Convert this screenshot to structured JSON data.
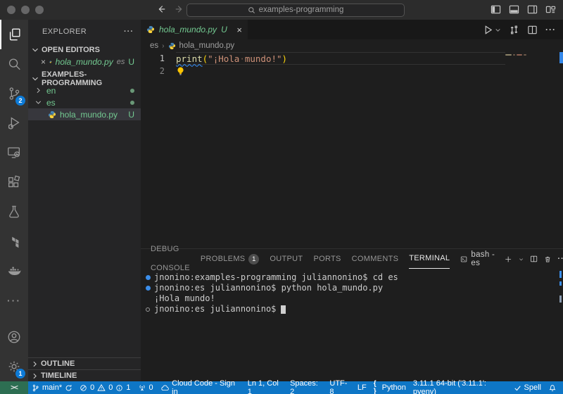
{
  "titlebar": {
    "search": "examples-programming"
  },
  "activity_bar": {
    "scm_badge": "2",
    "settings_badge": "1"
  },
  "explorer": {
    "title": "EXPLORER",
    "open_editors": {
      "header": "OPEN EDITORS",
      "item": {
        "name": "hola_mundo.py",
        "folder": "es",
        "git": "U"
      }
    },
    "workspace": {
      "header": "EXAMPLES-PROGRAMMING",
      "folders": [
        {
          "label": "en"
        },
        {
          "label": "es"
        }
      ],
      "file": {
        "label": "hola_mundo.py",
        "git": "U"
      }
    },
    "outline_header": "OUTLINE",
    "timeline_header": "TIMELINE"
  },
  "editor": {
    "tab": {
      "name": "hola_mundo.py",
      "git": "U"
    },
    "breadcrumb": {
      "folder": "es",
      "file": "hola_mundo.py"
    },
    "line_numbers": {
      "l1": "1",
      "l2": "2"
    },
    "code": {
      "fn": "print",
      "p1": "(",
      "s1": "\"¡Hola",
      "ws": "·",
      "s2": "mundo!\"",
      "p2": ")"
    }
  },
  "panel": {
    "tabs": [
      "DEBUG CONSOLE",
      "PROBLEMS",
      "OUTPUT",
      "PORTS",
      "COMMENTS",
      "TERMINAL"
    ],
    "problems_badge": "1",
    "shell_label": "bash - es",
    "terminal_lines": [
      {
        "text": "jnonino:examples-programming juliannonino$ cd es"
      },
      {
        "text": "jnonino:es juliannonino$ python hola_mundo.py"
      },
      {
        "text": "¡Hola mundo!"
      },
      {
        "text": "jnonino:es juliannonino$"
      }
    ]
  },
  "statusbar": {
    "remote": "><",
    "branch": "main*",
    "errors": "0",
    "warnings": "0",
    "infos": "1",
    "ports": "0",
    "cloud": "Cloud Code - Sign in",
    "cursor": "Ln 1, Col 1",
    "spaces": "Spaces: 2",
    "encoding": "UTF-8",
    "eol": "LF",
    "language": "Python",
    "interpreter": "3.11.1 64-bit ('3.11.1': pyenv)",
    "spell": "Spell"
  },
  "colors": {
    "status_blue": "#0e76c6",
    "remote_green": "#2d6e52",
    "git_green": "#73c991",
    "badge_blue": "#0d7ad6"
  }
}
